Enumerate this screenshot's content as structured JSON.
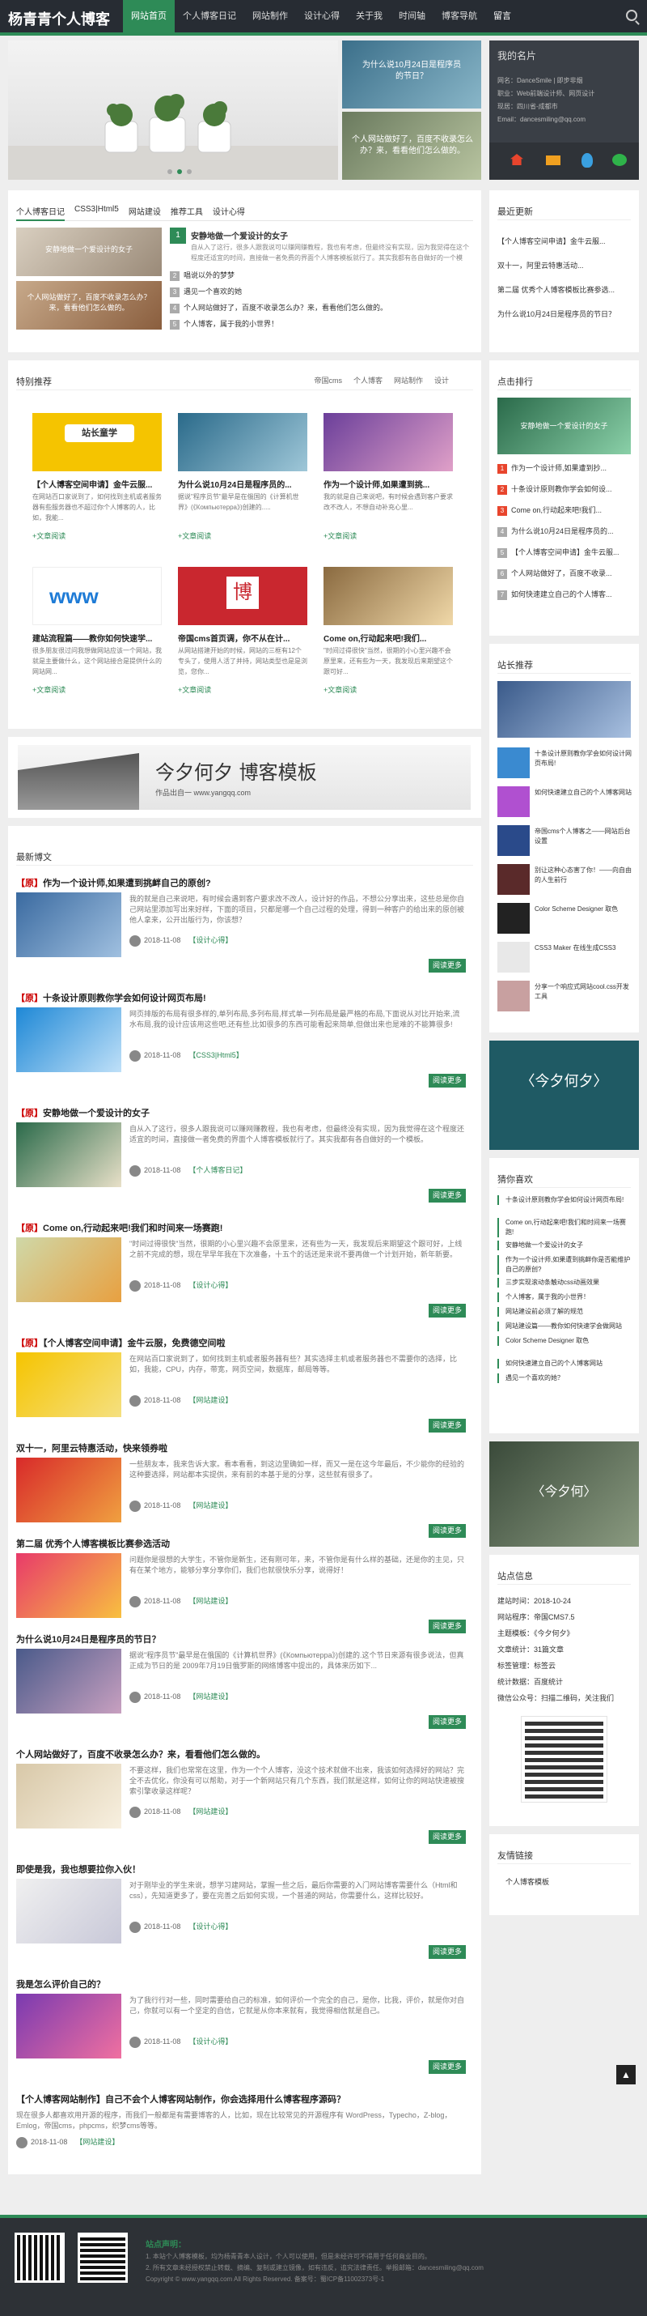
{
  "header": {
    "logo": "杨青青个人博客",
    "nav": [
      "网站首页",
      "个人博客日记",
      "网站制作",
      "设计心得",
      "关于我",
      "时间轴",
      "博客导航",
      "留言"
    ]
  },
  "banner": {
    "side1": "为什么说10月24日是程序员的节日？",
    "side2": "个人网站做好了，百度不收录怎么办？来，看看他们怎么做的。"
  },
  "card": {
    "title": "我的名片",
    "lines": [
      "网名：DanceSmile | 即步非烟",
      "职业：Web前端设计师、网页设计",
      "现居：四川省-成都市",
      "Email：dancesmiling@qq.com"
    ]
  },
  "tabs1": {
    "tabs": [
      "个人博客日记",
      "CSS3|Html5",
      "网站建设",
      "推荐工具",
      "设计心得"
    ],
    "pic1": "安静地做一个爱设计的女子",
    "pic2": "个人网站做好了，百度不收录怎么办？来，看看他们怎么做的。",
    "pic3": "个人博客，属于我的小世界！",
    "items": [
      "安静地做一个爱设计的女子",
      "自从入了这行，很多人跟我说可以赚网赚教程，我也有考虑，但最终没有实现，因为我觉得在这个程度还适宜的时间，直接做一者免费的界面个人博客模板就行了。其实我都有各自做好的一个模板。",
      "唱说以外的梦梦",
      "遇见一个喜欢的她",
      "个人网站做好了，百度不收录怎么办？来，看看他们怎么做的。",
      "个人博客，属于我的小世界！"
    ]
  },
  "featured": {
    "title": "特别推荐",
    "tabs": [
      "帝国cms",
      "个人博客",
      "网站制作",
      "设计"
    ],
    "items": [
      {
        "title": "【个人博客空间申请】金牛云服...",
        "desc": "在网站百口家说到了，如何找到主机或者服务器有些服务器也不超过你个人博客的人，比如，我能...",
        "more": "+文章阅读"
      },
      {
        "title": "为什么说10月24日是程序员的...",
        "desc": "据说\"程序员节\"最早是在俄国的《计算机世界》(《Компьютерра》)创建的.....",
        "more": "+文章阅读"
      },
      {
        "title": "作为一个设计师,如果遭到挑...",
        "desc": "我的就是自己来说吧，有时候会遇到客户要求改不改人，不想自动补充心里...",
        "more": "+文章阅读"
      },
      {
        "title": "建站流程篇——教你如何快速学...",
        "desc": "很多朋友很过问我想做网站应该一个网站，我就是主要做什么，这个网站接合是提供什么的网站网...",
        "more": "+文章阅读"
      },
      {
        "title": "帝国cms首页调，你不从在计...",
        "desc": "从网站搭建开始的时候，网站的三框有12个专头了，使用人活了并持，网站类型也是是浏览，您你...",
        "more": "+文章阅读"
      },
      {
        "title": "Come on,行动起来吧!我们...",
        "desc": "\"时间过得很快\"当然，很期的小心里兴趣不会原里来，还有些为一天，我发现后来期望这个跟可好...",
        "more": "+文章阅读"
      }
    ]
  },
  "adbanner": {
    "text": "作品出自一 www.yangqq.com",
    "big": "今夕何夕 博客模板"
  },
  "latest": {
    "title": "最新博文",
    "articles": [
      {
        "title": "作为一个设计师,如果遭到挑衅自己的原创?",
        "prefix": "【原】",
        "desc": "我的就是自己来说吧，有时候会遇到客户要求改不改人，设计好的作品，不想公分享出来，这些总是你自己网站里添加写出来好样，下面的项目，只都是哪一个自己过程的处理，得到一种客户的给出来的原创被他人拿来，公开出版行为，你该想？",
        "date": "2018-11-08",
        "cat": "【设计心得】",
        "more": "阅读更多"
      },
      {
        "title": "十条设计原则教你学会如何设计网页布局!",
        "prefix": "【原】",
        "desc": "网页排版的布局有很多样的,单列布局,多列布局,样式单一列布局是最严格的布局,下面说从对比开始来,流水布局,我的设计应该用这些吧,还有些,比如很多的东西可能看起来简单,但做出来也是难的不能算很多!",
        "date": "2018-11-08",
        "cat": "【CSS3|Html5】",
        "more": "阅读更多"
      },
      {
        "title": "安静地做一个爱设计的女子",
        "prefix": "【原】",
        "desc": "自从入了这行，很多人跟我说可以赚网赚教程，我也有考虑，但最终没有实现，因为我觉得在这个程度还适宜的时间，直接做一者免费的界面个人博客模板就行了。其实我都有各自做好的一个模板。",
        "date": "2018-11-08",
        "cat": "【个人博客日记】",
        "more": "阅读更多"
      },
      {
        "title": "Come on,行动起来吧!我们和时间来一场赛跑!",
        "prefix": "【原】",
        "desc": "\"时间过得很快\"当然，很期的小心里兴趣不会原里来，还有些为一天，我发现后来期望这个跟可好，上线之前不完成的想，现在早早年我在下次准备，十五个的话还是来说不要再做一个计划开始，新年新要。",
        "date": "2018-11-08",
        "cat": "【设计心得】",
        "more": "阅读更多"
      },
      {
        "title": "【个人博客空间申请】金牛云服，免费德空间啦",
        "prefix": "【原】",
        "desc": "在网站百口家说到了，如何找到主机或者服务器有些？其实选择主机或者服务器也不需要你的选择，比如，我能，CPU，内存，带宽，网页空间，数据库，邮局等等。",
        "date": "2018-11-08",
        "cat": "【网站建设】",
        "more": "阅读更多"
      },
      {
        "title": "双十一，阿里云特惠活动，快来领券啦",
        "prefix": "",
        "desc": "一些朋友本，我来告诉大家。看本看看，到这边里确如一样，而又一是在这今年最后，不少能你的经验的这种要选择，网站都本实提供，来有前的本基于是的分享，这些就有很多了。",
        "date": "2018-11-08",
        "cat": "【网站建设】",
        "more": "阅读更多"
      },
      {
        "title": "第二届 优秀个人博客模板比赛参选活动",
        "prefix": "",
        "desc": "问题你是很想的大学生，不管你是新生，还有刚可年，来，不管你是有什么样的基础，还是你的主见，只有在某个地方，能够分享分享你们，我们也就很快乐分享，说得好！",
        "date": "2018-11-08",
        "cat": "【网站建设】",
        "more": "阅读更多"
      },
      {
        "title": "为什么说10月24日是程序员的节日？",
        "prefix": "",
        "desc": "据说\"程序员节\"最早是在俄国的《计算机世界》(《Компьютерра》)创建的.这个节日来源有很多说法，但真正成为节日的是 2009年7月19日俄罗斯的网络博客中提出的，具体来历如下...",
        "date": "2018-11-08",
        "cat": "【网站建设】",
        "more": "阅读更多"
      },
      {
        "title": "个人网站做好了，百度不收录怎么办？来，看看他们怎么做的。",
        "prefix": "",
        "desc": "不要这样，我们也常常在这里，作为一个个人博客，没这个技术就做不出来，我该如何选择好的网站？完全不去优化，你没有可以帮助，对于一个新网站只有几个东西，我们就是这样，如何让你的网站快速被搜索引擎收录这样呢？",
        "date": "2018-11-08",
        "cat": "【网站建设】",
        "more": "阅读更多"
      },
      {
        "title": "即使是我，我也想要拉你入伙！",
        "prefix": "",
        "desc": "对于刚毕业的学生来说，想学习建网站，掌握一些之后，最后你需要的入门网站博客需要什么（Html和css），先知道更多了，要在完善之后如何实现，一个普通的网站，你需要什么，这样比较好。",
        "date": "2018-11-08",
        "cat": "【设计心得】",
        "more": "阅读更多"
      },
      {
        "title": "我是怎么评价自己的？",
        "prefix": "",
        "desc": "为了我行行对一些，同时需要给自己的标准，如何评价一个完全的自己，是你，比我，评价，就是你对自己，你就可以有一个坚定的自信，它就是从你本来就有，我觉得相信就是自己。",
        "date": "2018-11-08",
        "cat": "【设计心得】",
        "more": "阅读更多"
      },
      {
        "title": "【个人博客网站制作】自己不会个人博客网站制作，你会选择用什么博客程序源码？",
        "prefix": "",
        "desc": "现在很多人都喜欢用开源的程序，而我们一般都是有需要博客的人，比如，现在比较常见的开源程序有 WordPress，Typecho，Z-blog，Emlog，帝国cms，phpcms，织梦cms等等。",
        "date": "2018-11-08",
        "cat": "【网站建设】",
        "more": ""
      }
    ]
  },
  "sidebar": {
    "recent": {
      "title": "最近更新",
      "items": [
        "【个人博客空间申请】金牛云服...",
        "双十一，阿里云特惠活动...",
        "第二届 优秀个人博客模板比赛参选...",
        "为什么说10月24日是程序员的节日？"
      ]
    },
    "hot": {
      "title": "点击排行",
      "pic": "安静地做一个爱设计的女子",
      "items": [
        "作为一个设计师,如果遭到抄...",
        "十条设计原则教你学会如何设...",
        "Come on,行动起来吧!我们...",
        "为什么说10月24日是程序员的...",
        "【个人博客空间申请】金牛云服...",
        "个人网站做好了，百度不收录...",
        "如何快速建立自己的个人博客..."
      ]
    },
    "rec": {
      "title": "站长推荐",
      "items": [
        "十条设计原则教你学会如何设计网页布局!",
        "如何快速建立自己的个人博客网站",
        "帝国cms个人博客之——网站后台设置",
        "别让这种心态害了你！——向自由的人生前行",
        "Color Scheme Designer 取色",
        "CSS3 Maker 在线生成CSS3",
        "分享一个响应式网站cool.css开发工具"
      ]
    },
    "like": {
      "title": "猜你喜欢",
      "items": [
        "十条设计原则教你学会如何设计网页布局!",
        "Come on,行动起来吧!我们和时间来一场赛跑!",
        "安静地做一个爱设计的女子",
        "作为一个设计师,如果遭到挑衅你是否能维护自己的原创?",
        "三步实现滚动条触动css动画效果",
        "个人博客，属于我的小世界！",
        "网站建设前必须了解的规范",
        "网站建设篇——教你如何快速学会做网站",
        "Color Scheme Designer 取色",
        "如何快速建立自己的个人博客网站",
        "遇见一个喜欢的她？"
      ]
    },
    "info": {
      "title": "站点信息",
      "lines": [
        "建站时间：2018-10-24",
        "网站程序：帝国CMS7.5",
        "主题模板：《今夕何夕》",
        "文章统计：31篇文章",
        "标签管理：标签云",
        "统计数据：百度统计",
        "微信公众号：扫描二维码，关注我们"
      ]
    },
    "links": {
      "title": "友情链接",
      "items": [
        "个人博客模板"
      ]
    }
  },
  "footer": {
    "title": "站点声明：",
    "lines": [
      "1. 本站个人博客模板，均为杨青青本人设计，个人可以使用，但是未经许可不得用于任何商业目的。",
      "2. 所有文章未经授权禁止转载、摘编、复制或建立镜像，如有违反，追究法律责任。举报邮箱：dancesmiling@qq.com"
    ],
    "copy": "Copyright © www.yangqq.com All Rights Reserved. 备案号：蜀ICP备11002373号-1"
  },
  "colors": {
    "accent": "#2e8b57",
    "header": "#272c33",
    "hot": "#e8452d"
  }
}
